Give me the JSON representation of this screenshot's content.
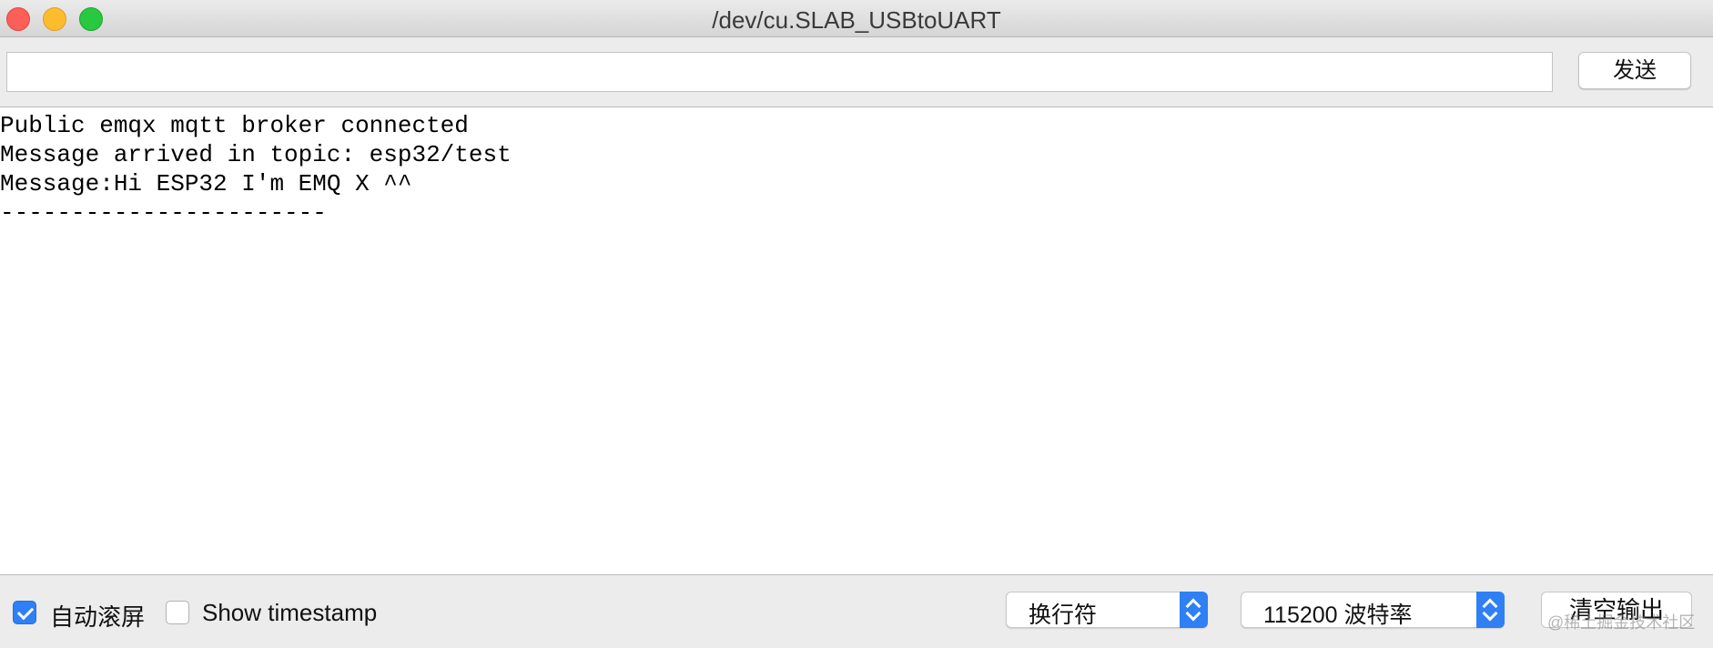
{
  "window": {
    "title": "/dev/cu.SLAB_USBtoUART"
  },
  "send": {
    "input_value": "",
    "button_label": "发送"
  },
  "output": {
    "lines": [
      "Public emqx mqtt broker connected",
      "Message arrived in topic: esp32/test",
      "Message:Hi ESP32 I'm EMQ X ^^",
      "-----------------------"
    ]
  },
  "bottom": {
    "autoscroll": {
      "label": "自动滚屏",
      "checked": true
    },
    "timestamp": {
      "label": "Show timestamp",
      "checked": false
    },
    "line_ending": {
      "selected": "换行符"
    },
    "baud_rate": {
      "selected": "115200 波特率"
    },
    "clear_button": "清空输出",
    "watermark": "@稀土掘金技术社区"
  },
  "colors": {
    "accent": "#2f7ff5",
    "close": "#fc5f57",
    "minimize": "#fdbc2e",
    "maximize": "#28c840"
  }
}
